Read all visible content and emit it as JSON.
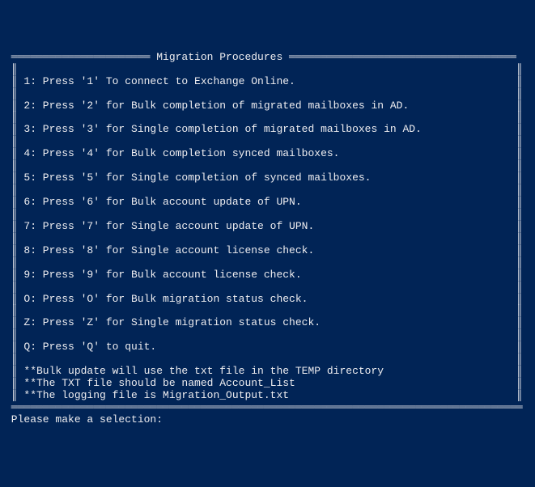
{
  "border_char": "═",
  "side_char": "║",
  "title": " Migration Procedures ",
  "menu": [
    {
      "key": "1",
      "desc": "Press '1' To connect to Exchange Online."
    },
    {
      "key": "2",
      "desc": "Press '2' for Bulk completion of migrated mailboxes in AD."
    },
    {
      "key": "3",
      "desc": "Press '3' for Single completion of migrated mailboxes in AD."
    },
    {
      "key": "4",
      "desc": "Press '4' for Bulk completion synced mailboxes."
    },
    {
      "key": "5",
      "desc": "Press '5' for Single completion of synced mailboxes."
    },
    {
      "key": "6",
      "desc": "Press '6' for Bulk account update of UPN."
    },
    {
      "key": "7",
      "desc": "Press '7' for Single account update of UPN."
    },
    {
      "key": "8",
      "desc": "Press '8' for Single account license check."
    },
    {
      "key": "9",
      "desc": "Press '9' for Bulk account license check."
    },
    {
      "key": "O",
      "desc": "Press 'O' for Bulk migration status check."
    },
    {
      "key": "Z",
      "desc": "Press 'Z' for Single migration status check."
    },
    {
      "key": "Q",
      "desc": "Press 'Q' to quit."
    }
  ],
  "notes": [
    "**Bulk update will use the txt file in the TEMP directory",
    "**The TXT file should be named Account_List",
    "**The logging file is Migration_Output.txt"
  ],
  "prompt": "Please make a selection:",
  "width": 82
}
